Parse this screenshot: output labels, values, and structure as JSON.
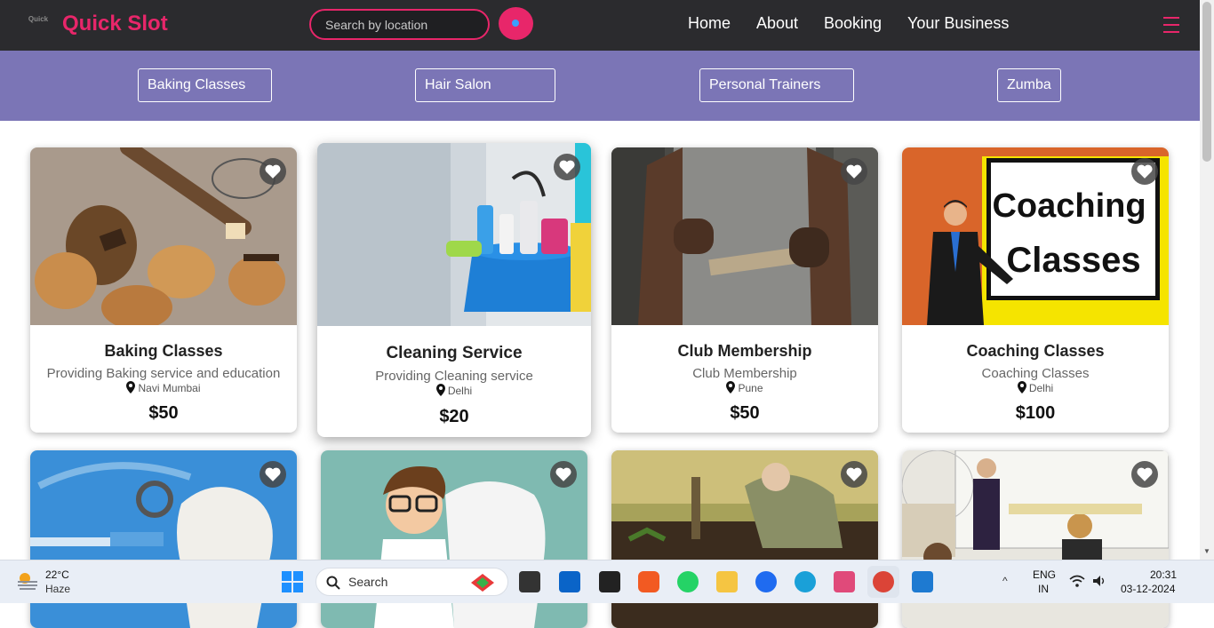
{
  "brand": {
    "name": "Quick Slot",
    "logo_text": "Quick"
  },
  "search": {
    "placeholder": "Search by location"
  },
  "nav": {
    "links": [
      "Home",
      "About",
      "Booking",
      "Your Business"
    ]
  },
  "categories": [
    "Baking Classes",
    "Hair Salon",
    "Personal Trainers",
    "Zumba"
  ],
  "cards": [
    {
      "title": "Baking Classes",
      "description": "Providing Baking service and education",
      "location": "Navi Mumbai",
      "price": "$50"
    },
    {
      "title": "Cleaning Service",
      "description": "Providing Cleaning service",
      "location": "Delhi",
      "price": "$20"
    },
    {
      "title": "Club Membership",
      "description": "Club Membership",
      "location": "Pune",
      "price": "$50"
    },
    {
      "title": "Coaching Classes",
      "description": "Coaching Classes",
      "location": "Delhi",
      "price": "$100",
      "image_text_1": "Coaching",
      "image_text_2": "Classes"
    }
  ],
  "taskbar": {
    "weather_temp": "22°C",
    "weather_desc": "Haze",
    "search_label": "Search",
    "lang_1": "ENG",
    "lang_2": "IN",
    "time": "20:31",
    "date": "03-12-2024"
  },
  "colors": {
    "accent": "#e8266a",
    "navbar": "#2b2b2e",
    "category_bar": "#7b75b6"
  }
}
